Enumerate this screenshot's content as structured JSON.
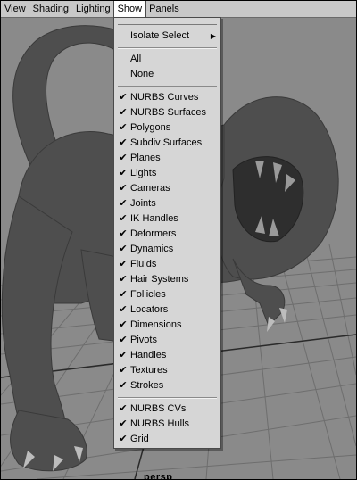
{
  "menubar": {
    "items": [
      "View",
      "Shading",
      "Lighting",
      "Show",
      "Panels"
    ],
    "active_index": 3
  },
  "camera_label": "persp",
  "show_menu": {
    "isolate_select": "Isolate Select",
    "all": "All",
    "none": "None",
    "items": [
      {
        "label": "NURBS Curves",
        "checked": true
      },
      {
        "label": "NURBS Surfaces",
        "checked": true
      },
      {
        "label": "Polygons",
        "checked": true
      },
      {
        "label": "Subdiv Surfaces",
        "checked": true
      },
      {
        "label": "Planes",
        "checked": true
      },
      {
        "label": "Lights",
        "checked": true
      },
      {
        "label": "Cameras",
        "checked": true
      },
      {
        "label": "Joints",
        "checked": true
      },
      {
        "label": "IK Handles",
        "checked": true
      },
      {
        "label": "Deformers",
        "checked": true
      },
      {
        "label": "Dynamics",
        "checked": true
      },
      {
        "label": "Fluids",
        "checked": true
      },
      {
        "label": "Hair Systems",
        "checked": true
      },
      {
        "label": "Follicles",
        "checked": true
      },
      {
        "label": "Locators",
        "checked": true
      },
      {
        "label": "Dimensions",
        "checked": true
      },
      {
        "label": "Pivots",
        "checked": true
      },
      {
        "label": "Handles",
        "checked": true
      },
      {
        "label": "Textures",
        "checked": true
      },
      {
        "label": "Strokes",
        "checked": true
      }
    ],
    "bottom_items": [
      {
        "label": "NURBS CVs",
        "checked": true
      },
      {
        "label": "NURBS Hulls",
        "checked": true
      },
      {
        "label": "Grid",
        "checked": true
      }
    ],
    "check_glyph": "✔"
  },
  "colors": {
    "viewport_bg": "#8a8a8a",
    "menu_bg": "#d6d6d6",
    "model": "#4e4e4e"
  }
}
